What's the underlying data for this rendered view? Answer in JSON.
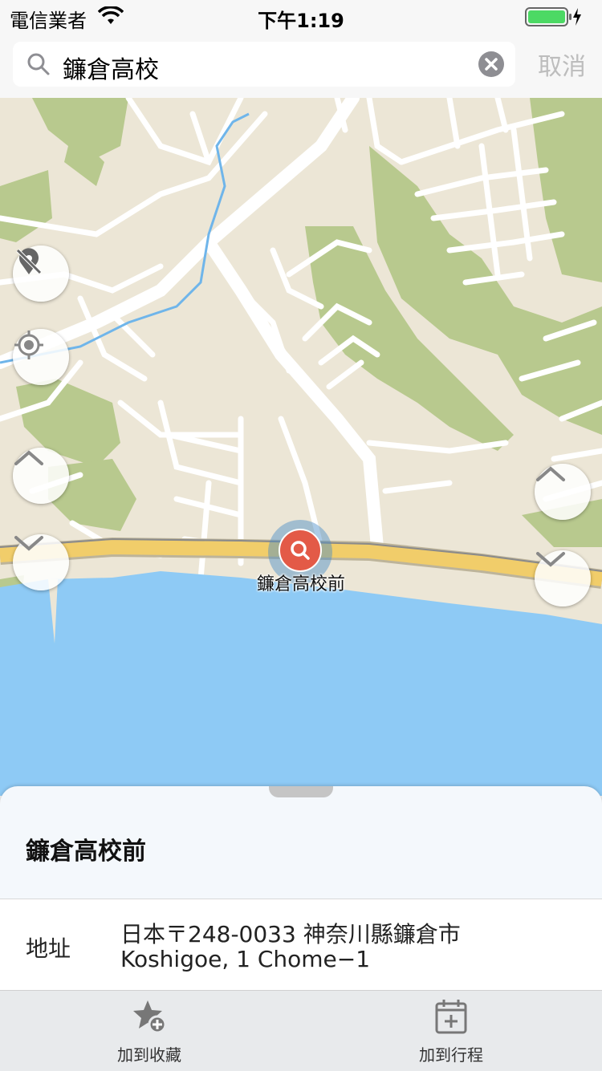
{
  "status_bar": {
    "carrier": "電信業者",
    "time": "下午1:19",
    "wifi_icon": "wifi-icon",
    "battery_icon": "battery-charging-icon"
  },
  "search": {
    "query": "鐮倉高校",
    "search_icon": "search-icon",
    "clear_icon": "clear-icon",
    "cancel_label": "取消"
  },
  "map": {
    "pin_label": "鐮倉高校前",
    "controls": [
      {
        "name": "hide-location-pin-icon"
      },
      {
        "name": "locate-me-icon"
      },
      {
        "name": "chevron-up-icon"
      },
      {
        "name": "chevron-down-icon"
      }
    ],
    "colors": {
      "land": "#ece6d6",
      "water": "#8ecaf5",
      "park": "#b8c98e",
      "road": "#ffffff",
      "highway": "#f1cd6a",
      "pin": "#e35a47"
    }
  },
  "sheet": {
    "title": "鐮倉高校前",
    "address_label": "地址",
    "address_line1": "日本〒248-0033 神奈川縣鐮倉市",
    "address_line2": "Koshigoe, 1 Chome−1"
  },
  "toolbar": {
    "favorite_label": "加到收藏",
    "schedule_label": "加到行程"
  }
}
